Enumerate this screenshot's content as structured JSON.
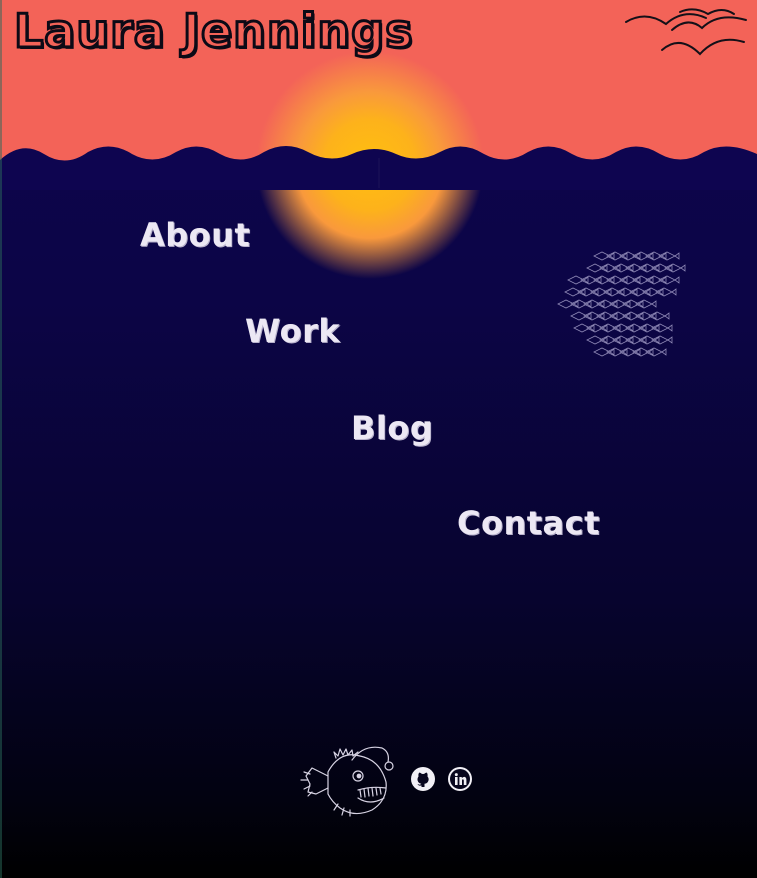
{
  "site": {
    "title": "Laura Jennings"
  },
  "nav": {
    "items": [
      {
        "label": "About"
      },
      {
        "label": "Work"
      },
      {
        "label": "Blog"
      },
      {
        "label": "Contact"
      }
    ]
  },
  "decor": {
    "birds_icon": "birds-icon",
    "fish_school_icon": "fish-school-icon",
    "anglerfish_icon": "anglerfish-icon"
  },
  "social": [
    {
      "icon": "github-icon"
    },
    {
      "icon": "linkedin-icon"
    }
  ],
  "colors": {
    "sky": "#f36358",
    "sun": "#ffbf10",
    "ocean_top": "#0e0550",
    "ocean_bottom": "#000000",
    "text": "#ece8f4"
  }
}
